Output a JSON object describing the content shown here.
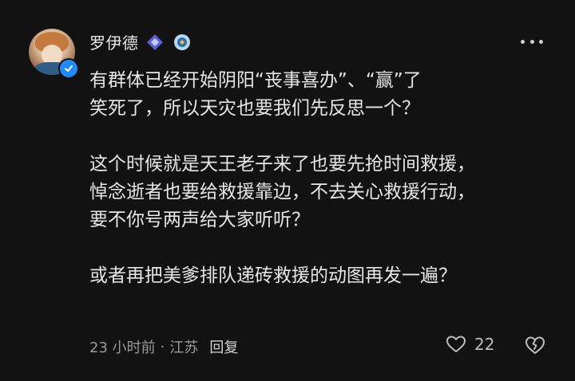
{
  "comment": {
    "username": "罗伊德",
    "paragraphs": [
      [
        "有群体已经开始阴阳“丧事喜办”、“赢”了",
        "笑死了，所以天灾也要我们先反思一个？"
      ],
      [
        "这个时候就是天王老子来了也要先抢时间救援，",
        "悼念逝者也要给救援靠边，不去关心救援行动，",
        "要不你号两声给大家听听？"
      ],
      [
        "或者再把美爹排队递砖救援的动图再发一遍？"
      ]
    ],
    "time": "23 小时前",
    "separator": "·",
    "location": "江苏",
    "reply_label": "回复",
    "like_count": "22"
  },
  "icons": {
    "avatar": "user-avatar",
    "verified": "verified-check-icon",
    "badge1": "diamond-badge-icon",
    "badge2": "emblem-badge-icon",
    "more": "more-dots-icon",
    "like": "heart-icon",
    "dislike": "broken-heart-icon"
  },
  "colors": {
    "background": "#121212",
    "text": "#e6e6e6",
    "meta": "#9a9a9a",
    "verified": "#1f8bff",
    "badge": "#5b5fd6"
  }
}
